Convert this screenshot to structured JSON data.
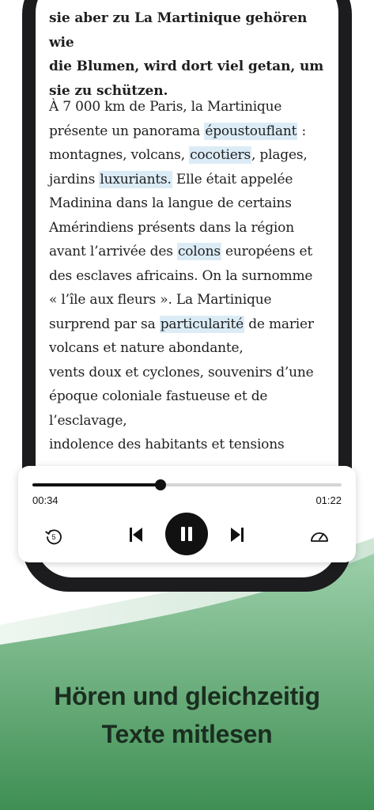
{
  "reader": {
    "bold_lines": [
      "sie aber zu La Martinique gehören wie",
      "die Blumen, wird dort viel getan, um",
      "sie zu schützen."
    ],
    "body_lines": [
      {
        "pre": "À 7 000 km de Paris, la Martinique",
        "hl": "",
        "post": ""
      },
      {
        "pre": "présente un panorama ",
        "hl": "époustouflant",
        "post": " :"
      },
      {
        "pre": "montagnes, volcans, ",
        "hl": "cocotiers",
        "post": ", plages,"
      },
      {
        "pre": "jardins ",
        "hl": "luxuriants.",
        "post": " Elle était appelée"
      },
      {
        "pre": "Madinina dans la langue de certains",
        "hl": "",
        "post": ""
      },
      {
        "pre": "Amérindiens présents dans la région",
        "hl": "",
        "post": ""
      },
      {
        "pre": "avant l’arrivée des ",
        "hl": "colons",
        "post": " européens et"
      },
      {
        "pre": "des esclaves africains. On la surnomme",
        "hl": "",
        "post": ""
      },
      {
        "pre": "« l’île aux fleurs ». La Martinique",
        "hl": "",
        "post": ""
      },
      {
        "pre": "surprend par sa ",
        "hl": "particularité",
        "post": " de marier"
      },
      {
        "pre": "volcans et nature abondante,",
        "hl": "",
        "post": ""
      },
      {
        "pre": "vents doux et cyclones, souvenirs d’une",
        "hl": "",
        "post": ""
      },
      {
        "pre": "époque coloniale fastueuse et de",
        "hl": "",
        "post": ""
      },
      {
        "pre": "l’esclavage,",
        "hl": "",
        "post": ""
      },
      {
        "pre": "indolence des habitants et tensions",
        "hl": "",
        "post": ""
      }
    ]
  },
  "player": {
    "elapsed": "00:34",
    "duration": "01:22",
    "progress": 0.414,
    "rewind_seconds": "5",
    "icons": {
      "rewind": "rewind-5-icon",
      "previous": "skip-previous-icon",
      "pause": "pause-icon",
      "next": "skip-next-icon",
      "speed": "speedometer-icon"
    }
  },
  "headline": {
    "line1": "Hören und gleichzeitig",
    "line2": "Texte mitlesen"
  },
  "colors": {
    "highlight": "#dcecf6",
    "green_top": "#8fc79e",
    "green_bottom": "#3e8f53",
    "headline": "#1a2e20"
  }
}
